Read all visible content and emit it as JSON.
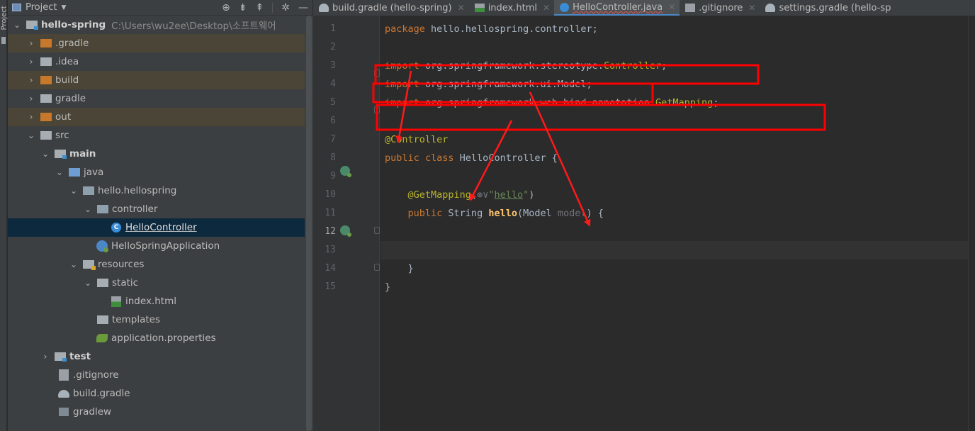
{
  "side_strip": {
    "label": "Project"
  },
  "panel": {
    "title": "Project"
  },
  "tree": {
    "root": {
      "name": "hello-spring",
      "path": "C:\\Users\\wu2ee\\Desktop\\소프트웨어"
    },
    "gradle_dir": ".gradle",
    "idea": ".idea",
    "build": "build",
    "gradle": "gradle",
    "out": "out",
    "src": "src",
    "main": "main",
    "java": "java",
    "pkg": "hello.hellospring",
    "controller": "controller",
    "hello_controller": "HelloController",
    "app": "HelloSpringApplication",
    "resources": "resources",
    "static": "static",
    "index_html": "index.html",
    "templates": "templates",
    "app_props": "application.properties",
    "test": "test",
    "gitignore": ".gitignore",
    "build_gradle": "build.gradle",
    "gradlew": "gradlew"
  },
  "tabs": [
    {
      "label": "build.gradle (hello-spring)"
    },
    {
      "label": "index.html"
    },
    {
      "label": "HelloController.java"
    },
    {
      "label": ".gitignore"
    },
    {
      "label": "settings.gradle (hello-sp"
    }
  ],
  "line_numbers": [
    "1",
    "2",
    "3",
    "4",
    "5",
    "6",
    "7",
    "8",
    "9",
    "10",
    "11",
    "12",
    "13",
    "14",
    "15"
  ],
  "code": {
    "l1_kw": "package",
    "l1_rest": " hello.hellospring.controller;",
    "l3_kw": "import",
    "l3_a": " org.springframework.stereotype.",
    "l3_b": "Controller",
    "l3_c": ";",
    "l4_kw": "import",
    "l4_rest": " org.springframework.ui.Model;",
    "l5_kw": "import",
    "l5_a": " org.springframework.web.bind.annotation.",
    "l5_b": "GetMapping",
    "l5_c": ";",
    "l7": "@Controller",
    "l8_kw": "public class",
    "l8_rest": " HelloController {",
    "l10_ann": "@GetMapping",
    "l10_open": "(",
    "l10_glyph": "⊛∨",
    "l10_q1": "\"",
    "l10_str": "hello",
    "l10_q2": "\"",
    "l10_close": ")",
    "l11_kw": "public",
    "l11_a": " String ",
    "l11_fn": "hello",
    "l11_b": "(Model ",
    "l11_param": "model",
    "l11_c": ") {",
    "l13": "}",
    "l14": "}"
  },
  "colors": {
    "annotation_box": "#ff0000",
    "arrow": "#ff1a1a"
  }
}
